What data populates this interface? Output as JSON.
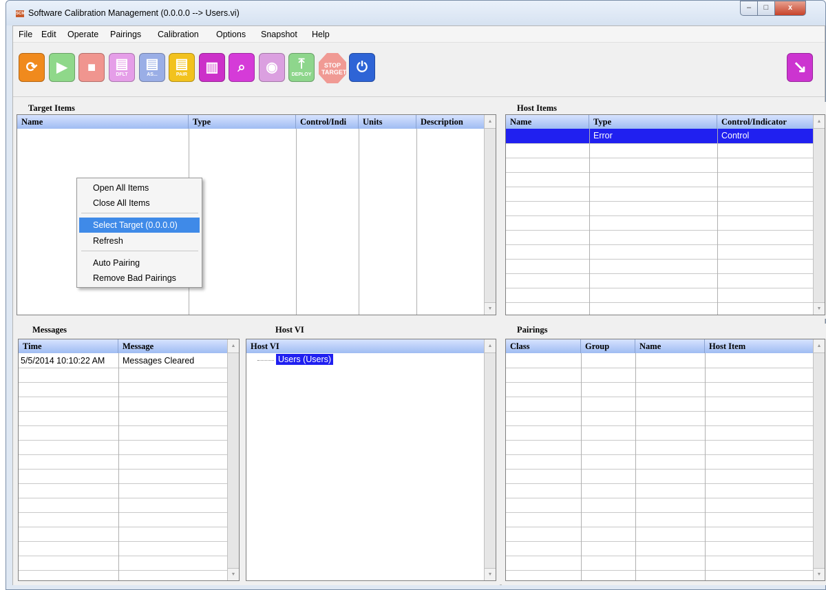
{
  "window": {
    "title": "Software Calibration Management (0.0.0.0 --> Users.vi)",
    "app_icon_text": "SCM",
    "controls": {
      "minimize": "–",
      "maximize": "□",
      "close": "x"
    }
  },
  "menu": [
    "File",
    "Edit",
    "Operate",
    "Pairings",
    "Calibration",
    "Options",
    "Snapshot",
    "Help"
  ],
  "toolbar": {
    "buttons": [
      {
        "name": "refresh",
        "glyph": "⟳",
        "label": "",
        "color": "#f08a1d"
      },
      {
        "name": "run",
        "glyph": "▶",
        "label": "",
        "color": "#8fd88a"
      },
      {
        "name": "stop",
        "glyph": "■",
        "label": "",
        "color": "#f0958f"
      },
      {
        "name": "save-default",
        "glyph": "▤",
        "label": "DFLT",
        "color": "#e59ee8"
      },
      {
        "name": "save-as",
        "glyph": "▤",
        "label": "AS...",
        "color": "#9aaee6"
      },
      {
        "name": "save-pair",
        "glyph": "▤",
        "label": "PAIR",
        "color": "#f2c21e"
      },
      {
        "name": "document",
        "glyph": "▥",
        "label": "",
        "color": "#cc30c9"
      },
      {
        "name": "search",
        "glyph": "⌕",
        "label": "",
        "color": "#d53bd8"
      },
      {
        "name": "camera",
        "glyph": "◉",
        "label": "",
        "color": "#dba0e0"
      },
      {
        "name": "deploy",
        "glyph": "⤒",
        "label": "DEPLOY",
        "color": "#8ed68c"
      },
      {
        "name": "stop-target",
        "glyph": "",
        "label": "STOP TARGET",
        "color": "#f09a94"
      },
      {
        "name": "power",
        "glyph": "⏻",
        "label": "",
        "color": "#2e64d6"
      }
    ],
    "exit": {
      "glyph": "↘",
      "color": "#cc34d0"
    }
  },
  "target_items": {
    "title": "Target Items",
    "columns": [
      "Name",
      "Type",
      "Control/Indi",
      "Units",
      "Description"
    ]
  },
  "host_items": {
    "title": "Host Items",
    "columns": [
      "Name",
      "Type",
      "Control/Indicator"
    ],
    "rows": [
      {
        "name": "",
        "type": "Error",
        "ci": "Control"
      }
    ]
  },
  "messages": {
    "title": "Messages",
    "columns": [
      "Time",
      "Message"
    ],
    "rows": [
      {
        "time": "5/5/2014 10:10:22 AM",
        "message": "Messages Cleared"
      }
    ]
  },
  "host_vi": {
    "title": "Host VI",
    "column": "Host VI",
    "tree_item": "Users (Users)"
  },
  "pairings": {
    "title": "Pairings",
    "columns": [
      "Class",
      "Group",
      "Name",
      "Host Item"
    ]
  },
  "context_menu": {
    "items": [
      "Open All Items",
      "Close All Items",
      "Select Target (0.0.0.0)",
      "Refresh",
      "Auto Pairing",
      "Remove Bad Pairings"
    ],
    "selected": "Select Target (0.0.0.0)"
  },
  "colors": {
    "selection": "#2020f0",
    "menu_highlight": "#3f8ae8",
    "header": "#9fbcf2"
  }
}
